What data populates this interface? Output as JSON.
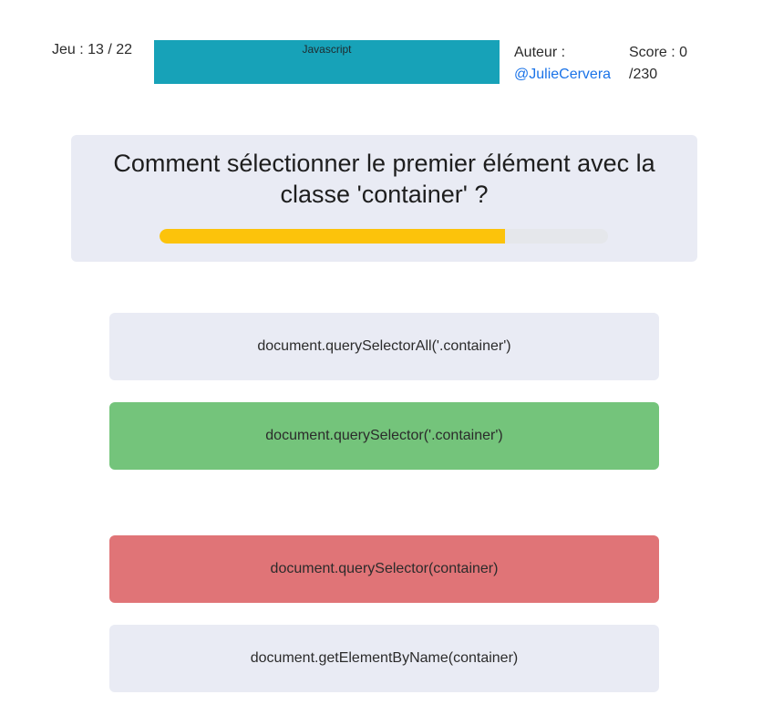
{
  "header": {
    "game_counter": "Jeu : 13 / 22",
    "category": "Javascript",
    "author_label": "Auteur :",
    "author_handle": "@JulieCervera",
    "score_label": "Score : 0",
    "score_total": "/230"
  },
  "question": {
    "text": "Comment sélectionner le premier élément avec la classe  'container' ?",
    "progress_percent": 77
  },
  "answers": [
    {
      "label": "document.querySelectorAll('.container')",
      "state": "neutral"
    },
    {
      "label": "document.querySelector('.container')",
      "state": "correct"
    },
    {
      "label": "document.querySelector(container)",
      "state": "wrong"
    },
    {
      "label": "document.getElementByName(container)",
      "state": "neutral"
    }
  ],
  "colors": {
    "category_banner": "#17a2b8",
    "card_background": "#e9ebf4",
    "progress_fill": "#fcc30b",
    "correct": "#74c47b",
    "wrong": "#e07477",
    "link": "#1a73e8"
  }
}
